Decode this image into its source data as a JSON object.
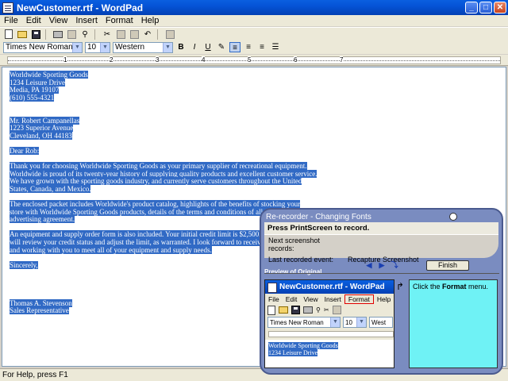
{
  "window": {
    "title": "NewCustomer.rtf - WordPad",
    "controls": [
      "_",
      "□",
      "✕"
    ]
  },
  "menu": [
    "File",
    "Edit",
    "View",
    "Insert",
    "Format",
    "Help"
  ],
  "format_bar": {
    "font": "Times New Roman",
    "size": "10",
    "script": "Western",
    "bold": "B",
    "italic": "I",
    "underline": "U"
  },
  "ruler": {
    "marks": [
      "1",
      "2",
      "3",
      "4",
      "5",
      "6",
      "7"
    ]
  },
  "document": {
    "lines": [
      "Worldwide Sporting Goods",
      "1234 Leisure Drive",
      "Media, PA 19107",
      "(610) 555-4321",
      "",
      "",
      "Mr. Robert Campanellas",
      "1223 Superior Avenue",
      "Cleveland, OH  44183",
      "",
      "Dear Rob:",
      "",
      "Thank you for choosing Worldwide Sporting Goods as your primary supplier of recreational equipment.",
      "Worldwide is proud of its twenty-year history of supplying quality products and excellent customer service.",
      "We have grown with the sporting goods industry, and currently serve customers throughout the United",
      "States, Canada, and Mexico.",
      "",
      "The enclosed packet includes Worldwide's product catalog, highlights of the benefits of stocking your",
      "store with Worldwide Sporting Goods products, details of the terms and conditions of all sales, and",
      "advertising agreement.",
      "",
      "An equipment and supply order form is also included. Your initial credit limit is $2,500. After six months, we",
      "will review your credit status and adjust the limit, as warranted. I look forward to receiving your first order",
      "and working with you to meet all of your equipment and supply needs.",
      "",
      "Sincerely,",
      "",
      "",
      "",
      "",
      "Thomas A. Stevenson",
      "Sales Representative"
    ]
  },
  "status": "For Help, press F1",
  "recorder": {
    "title": "Re-recorder - Changing Fonts",
    "headline": "Press PrintScreen to record.",
    "next_label": "Next screenshot records:",
    "next_value": "",
    "last_label": "Last recorded event:",
    "last_value": "Recapture Screenshot",
    "finish_label": "Finish",
    "preview_label": "Preview of Original",
    "instruction_prefix": "Click the ",
    "instruction_bold": "Format",
    "instruction_suffix": " menu."
  },
  "preview": {
    "title": "NewCustomer.rtf - WordPad",
    "menu": [
      "File",
      "Edit",
      "View",
      "Insert",
      "Format",
      "Help"
    ],
    "highlighted_menu": "Format",
    "font": "Times New Roman",
    "size": "10",
    "script": "West",
    "doc_lines": [
      "Worldwide Sporting Goods",
      "1234 Leisure Drive"
    ]
  },
  "colors": {
    "selection": "#316ac5",
    "instruction_bg": "#6ff2f5",
    "recorder_frame": "#7a8cc0"
  }
}
